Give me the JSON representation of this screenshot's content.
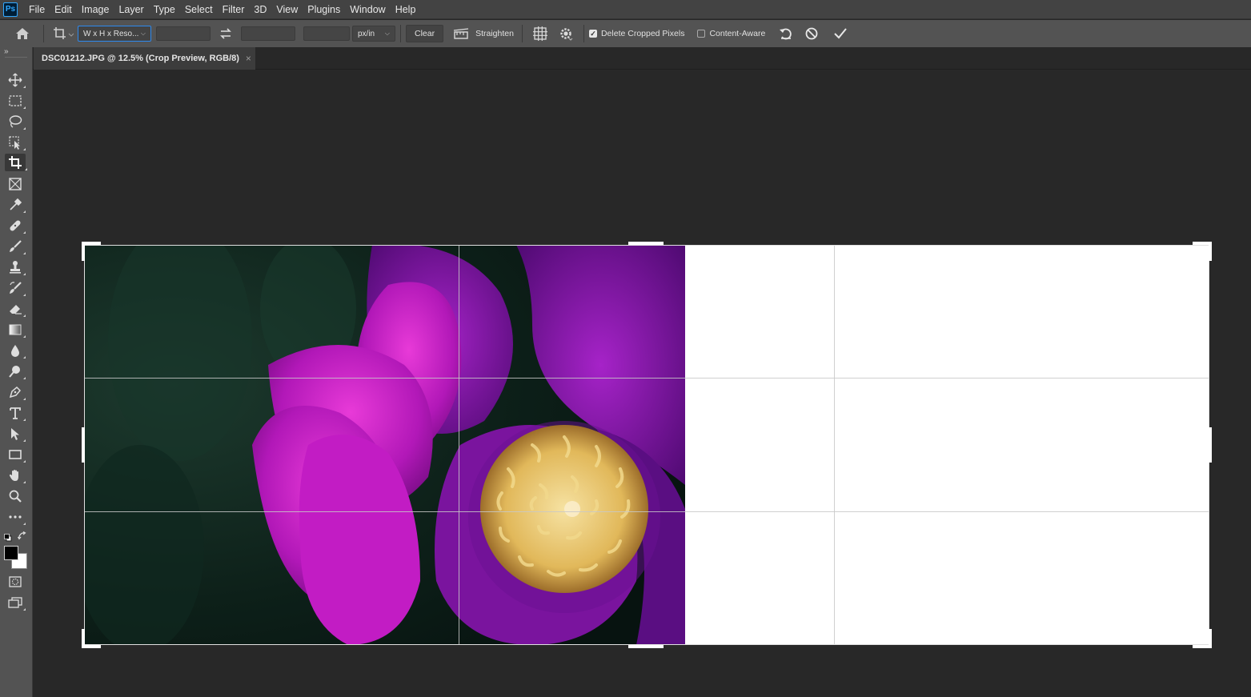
{
  "app": {
    "logo": "Ps"
  },
  "menu": [
    "File",
    "Edit",
    "Image",
    "Layer",
    "Type",
    "Select",
    "Filter",
    "3D",
    "View",
    "Plugins",
    "Window",
    "Help"
  ],
  "options": {
    "ratio_preset": "W x H x Reso...",
    "width_value": "",
    "height_value": "",
    "resolution_value": "",
    "unit": "px/in",
    "clear_label": "Clear",
    "straighten_label": "Straighten",
    "delete_cropped_label": "Delete Cropped Pixels",
    "delete_cropped_checked": true,
    "content_aware_label": "Content-Aware",
    "content_aware_checked": false
  },
  "document": {
    "tab_title": "DSC01212.JPG @ 12.5% (Crop Preview, RGB/8)",
    "close_glyph": "×"
  },
  "colors": {
    "accent": "#2d89ef",
    "annotation_arrow": "#e0583a",
    "foreground": "#000000",
    "background": "#ffffff"
  },
  "tools": [
    "move-tool",
    "marquee-tool",
    "lasso-tool",
    "object-selection-tool",
    "crop-tool",
    "frame-tool",
    "eyedropper-tool",
    "healing-brush-tool",
    "brush-tool",
    "clone-stamp-tool",
    "history-brush-tool",
    "eraser-tool",
    "gradient-tool",
    "blur-tool",
    "dodge-tool",
    "pen-tool",
    "type-tool",
    "path-selection-tool",
    "rectangle-tool",
    "hand-tool",
    "zoom-tool",
    "more-tools"
  ],
  "active_tool": "crop-tool"
}
